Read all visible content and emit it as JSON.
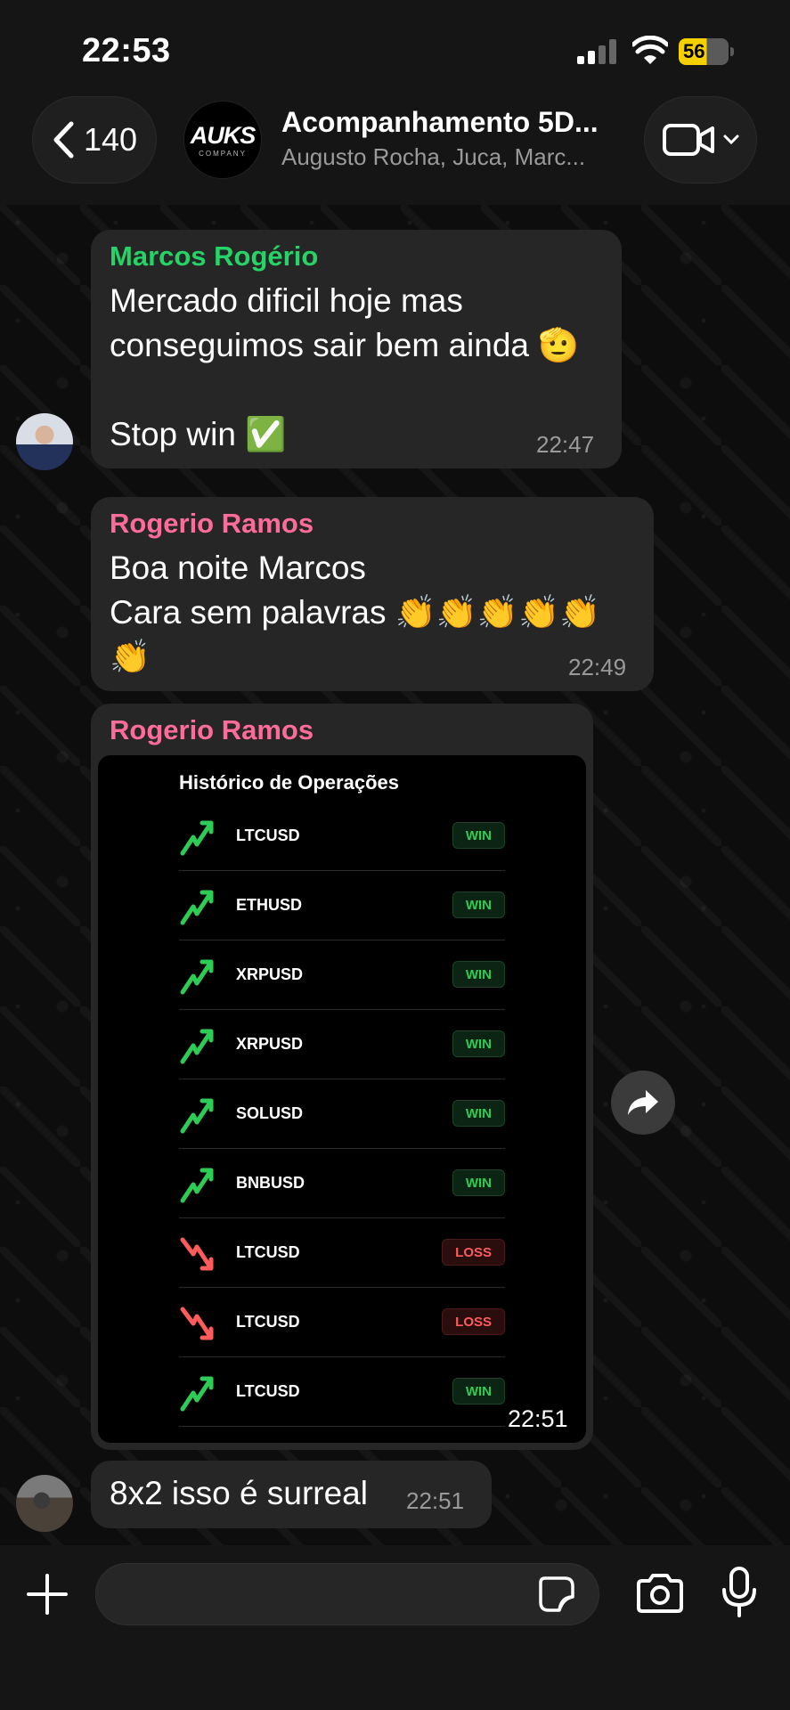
{
  "status_bar": {
    "time": "22:53",
    "battery": "56"
  },
  "header": {
    "back_count": "140",
    "group_logo": "AUKS",
    "group_logo_sub": "COMPANY",
    "title": "Acompanhamento 5D...",
    "members": "Augusto Rocha, Juca, Marc..."
  },
  "messages": [
    {
      "sender": "Marcos Rogério",
      "text": "Mercado dificil hoje mas\nconseguimos sair bem ainda 🫡\n\nStop win ✅",
      "time": "22:47"
    },
    {
      "sender": "Rogerio Ramos",
      "text": "Boa noite Marcos\nCara sem palavras 👏👏👏👏👏\n👏",
      "time": "22:49"
    },
    {
      "sender": "Rogerio Ramos",
      "time": "22:51",
      "image": {
        "title": "Histórico de Operações",
        "operations": [
          {
            "symbol": "LTCUSD",
            "result": "WIN",
            "direction": "up"
          },
          {
            "symbol": "ETHUSD",
            "result": "WIN",
            "direction": "up"
          },
          {
            "symbol": "XRPUSD",
            "result": "WIN",
            "direction": "up"
          },
          {
            "symbol": "XRPUSD",
            "result": "WIN",
            "direction": "up"
          },
          {
            "symbol": "SOLUSD",
            "result": "WIN",
            "direction": "up"
          },
          {
            "symbol": "BNBUSD",
            "result": "WIN",
            "direction": "up"
          },
          {
            "symbol": "LTCUSD",
            "result": "LOSS",
            "direction": "down"
          },
          {
            "symbol": "LTCUSD",
            "result": "LOSS",
            "direction": "down"
          },
          {
            "symbol": "LTCUSD",
            "result": "WIN",
            "direction": "up"
          }
        ]
      }
    },
    {
      "text": "8x2 isso é surreal",
      "time": "22:51"
    }
  ],
  "input": {
    "placeholder": ""
  },
  "colors": {
    "green_sender": "#25d366",
    "pink_sender": "#ff6b9a",
    "win": "#2ecc55",
    "loss": "#ff5b5b",
    "battery": "#f5d000"
  }
}
